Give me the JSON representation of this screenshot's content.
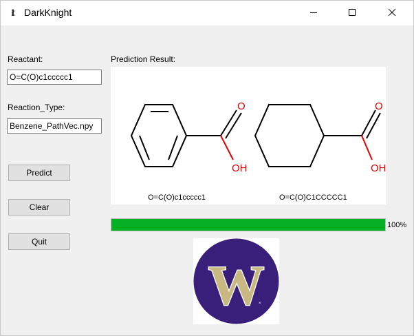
{
  "window": {
    "title": "DarkKnight",
    "icon": "chess-knight-icon"
  },
  "form": {
    "reactant_label": "Reactant:",
    "reactant_value": "O=C(O)c1ccccc1",
    "reaction_type_label": "Reaction_Type:",
    "reaction_type_value": "Benzene_PathVec.npy"
  },
  "buttons": {
    "predict": "Predict",
    "clear": "Clear",
    "quit": "Quit"
  },
  "result": {
    "label": "Prediction Result:",
    "molecules": [
      {
        "smiles": "O=C(O)c1ccccc1",
        "atom_labels": {
          "carbonyl_oxygen": "O",
          "hydroxyl": "OH"
        }
      },
      {
        "smiles": "O=C(O)C1CCCCC1",
        "atom_labels": {
          "carbonyl_oxygen": "O",
          "hydroxyl": "OH"
        }
      }
    ]
  },
  "progress": {
    "fraction": 1.0,
    "text": "100%",
    "color": "#06b025"
  },
  "logo": {
    "letter": "W",
    "circle_color": "#3a1f7a",
    "letter_color": "#c8b882"
  }
}
